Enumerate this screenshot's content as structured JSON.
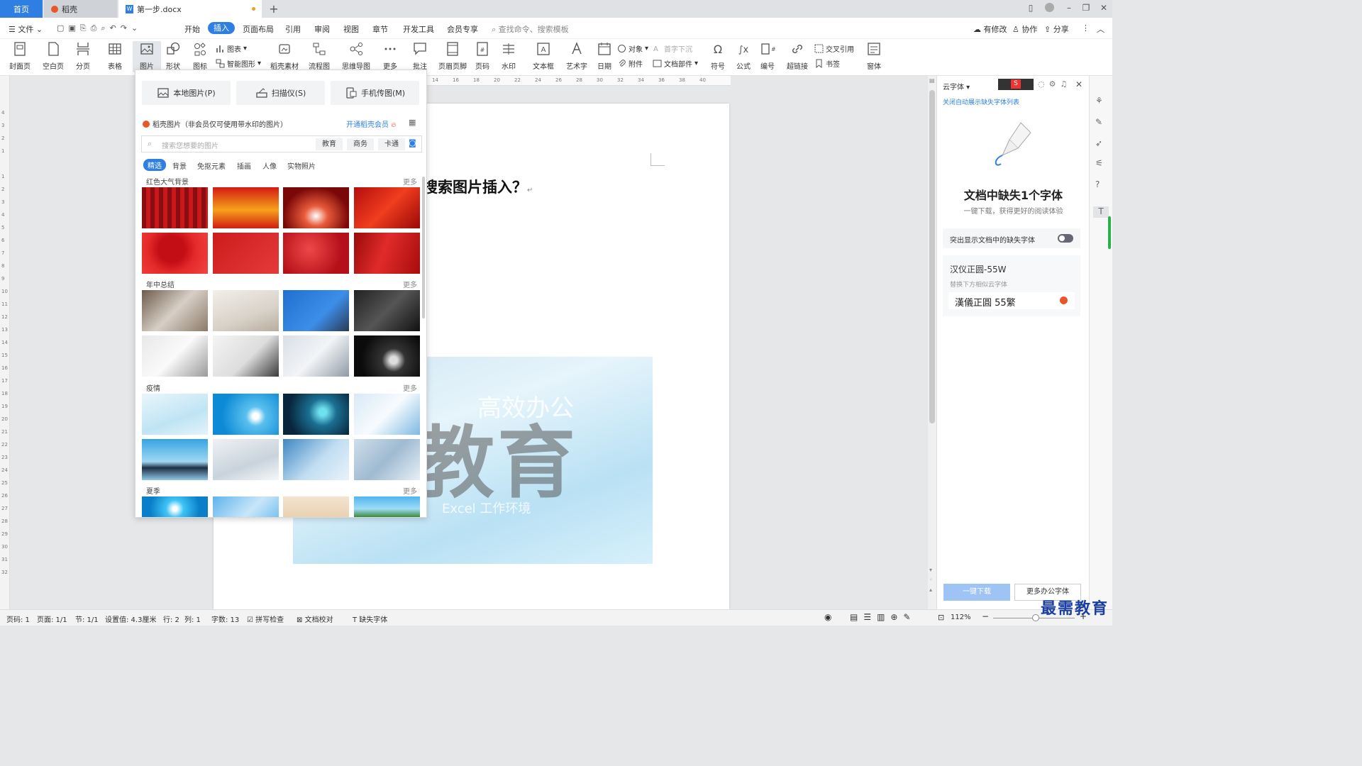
{
  "titlebar": {
    "home_tab": "首页",
    "daoke_tab": "稻壳",
    "doc_tab": "第一步.docx"
  },
  "menubar": {
    "file": "文件",
    "items": [
      "开始",
      "插入",
      "页面布局",
      "引用",
      "审阅",
      "视图",
      "章节",
      "开发工具",
      "会员专享"
    ],
    "active": "插入",
    "search_placeholder": "查找命令、搜索模板",
    "modified": "有修改",
    "collab": "协作",
    "share": "分享"
  },
  "ribbon": {
    "cover": "封面页",
    "blank": "空白页",
    "pagebreak": "分页",
    "table": "表格",
    "picture": "图片",
    "shape": "形状",
    "icons": "图标",
    "chart": "图表",
    "smartart": "智能图形",
    "daoke_material": "稻壳素材",
    "flowchart": "流程图",
    "mindmap": "思维导图",
    "more": "更多",
    "comment": "批注",
    "header_footer": "页眉页脚",
    "page_number": "页码",
    "watermark": "水印",
    "textbox": "文本框",
    "wordart": "艺术字",
    "date": "日期",
    "object": "对象",
    "attachment": "附件",
    "dropcap": "首字下沉",
    "doc_parts": "文档部件",
    "symbol": "符号",
    "formula": "公式",
    "numbering": "编号",
    "hyperlink": "超链接",
    "cross_ref": "交叉引用",
    "bookmark": "书签",
    "window": "窗体"
  },
  "ruler": {
    "h_ticks": [
      "14",
      "16",
      "18",
      "20",
      "22",
      "24",
      "26",
      "28",
      "30",
      "32",
      "34",
      "36",
      "38",
      "40"
    ],
    "v_ticks": [
      "4",
      "3",
      "2",
      "1",
      "1",
      "2",
      "3",
      "4",
      "5",
      "6",
      "7",
      "8",
      "9",
      "10",
      "11",
      "12",
      "13",
      "14",
      "15",
      "16",
      "17",
      "18",
      "19",
      "20",
      "21",
      "22",
      "23",
      "24",
      "25",
      "26",
      "27",
      "28",
      "29",
      "30",
      "31",
      "32"
    ]
  },
  "picture_panel": {
    "local_image": "本地图片(P)",
    "scanner": "扫描仪(S)",
    "phone_image": "手机传图(M)",
    "source_label": "稻壳图片（非会员仅可使用带水印的图片）",
    "vip_link": "开通稻壳会员",
    "search_placeholder": "搜索您想要的图片",
    "search_chips": [
      "教育",
      "商务",
      "卡通"
    ],
    "categories": [
      "精选",
      "背景",
      "免抠元素",
      "插画",
      "人像",
      "实物照片"
    ],
    "active_category": "精选",
    "sections": [
      {
        "title": "红色大气背景",
        "more": "更多"
      },
      {
        "title": "年中总结",
        "more": "更多"
      },
      {
        "title": "疫情",
        "more": "更多"
      },
      {
        "title": "夏季",
        "more": "更多"
      }
    ]
  },
  "document": {
    "heading_fragment": "搜索图片插入？",
    "image_big_text": "需教育",
    "image_sub_text": "高效办公",
    "image_eng_text": "Excel 工作环境"
  },
  "font_pane": {
    "title": "云字体",
    "close_list": "关闭自动展示缺失字体列表",
    "missing_title": "文档中缺失1个字体",
    "missing_sub": "一键下载，获得更好的阅读体验",
    "highlight_label": "突出显示文档中的缺失字体",
    "font_name": "汉仪正圆-55W",
    "replace_hint": "替换下方相似云字体",
    "replacement_font": "漢儀正圓 55繁",
    "download_btn": "一键下载",
    "more_fonts_btn": "更多办公字体"
  },
  "statusbar": {
    "page_num": "页码: 1",
    "pages": "页面: 1/1",
    "section": "节: 1/1",
    "setting": "设置值: 4.3厘米",
    "row": "行: 2",
    "col": "列: 1",
    "wordcount": "字数: 13",
    "spellcheck": "拼写检查",
    "doccheck": "文档校对",
    "missing_font": "缺失字体",
    "zoom": "112%"
  },
  "watermark_text": "最需教育",
  "colors": {
    "accent": "#2f7fe3",
    "vip_orange": "#e8562a"
  }
}
